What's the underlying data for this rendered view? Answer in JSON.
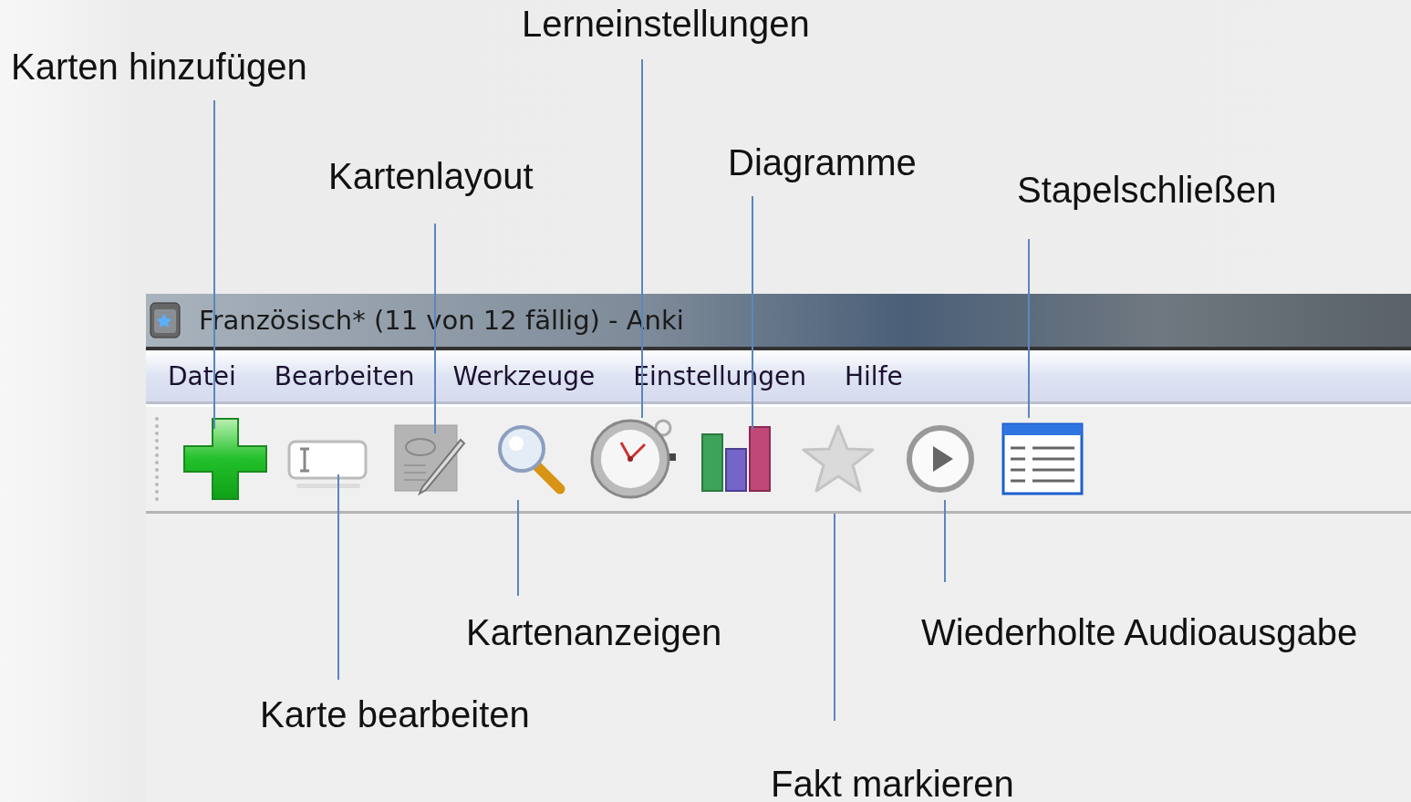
{
  "callouts": [
    "Lerneinstellungen",
    "Karten hinzufügen",
    "Diagramme",
    "Kartenlayout",
    "Stapelschließen",
    "Kartenanzeigen",
    "Wiederholte Audioausgabe",
    "Karte bearbeiten",
    "Fakt markieren"
  ],
  "window": {
    "title": "Französisch* (11 von 12 fällig) - Anki"
  },
  "menu": [
    "Datei",
    "Bearbeiten",
    "Werkzeuge",
    "Einstellungen",
    "Hilfe"
  ],
  "toolbar": [
    {
      "kind": "add"
    },
    {
      "kind": "edit"
    },
    {
      "kind": "layout"
    },
    {
      "kind": "browse"
    },
    {
      "kind": "timer"
    },
    {
      "kind": "graphs"
    },
    {
      "kind": "mark"
    },
    {
      "kind": "replay"
    },
    {
      "kind": "close"
    }
  ]
}
